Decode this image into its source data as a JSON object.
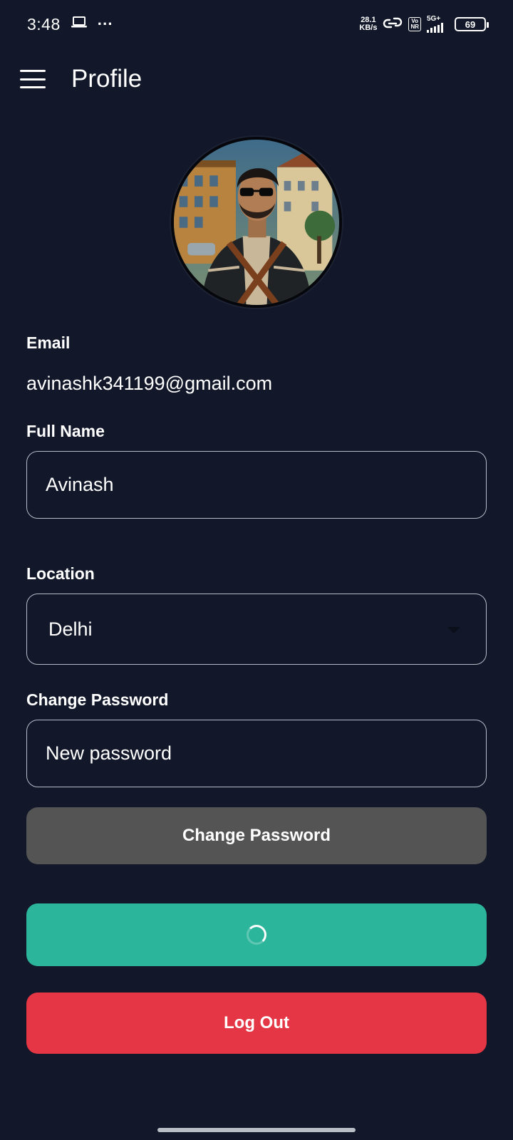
{
  "status_bar": {
    "time": "3:48",
    "overflow": "···",
    "net_speed_value": "28.1",
    "net_speed_unit": "KB/s",
    "volte_top": "Vo",
    "volte_bottom": "NR",
    "network": "5G+",
    "battery": "69"
  },
  "app_bar": {
    "title": "Profile"
  },
  "profile": {
    "email_label": "Email",
    "email_value": "avinashk341199@gmail.com",
    "full_name_label": "Full Name",
    "full_name_value": "Avinash",
    "location_label": "Location",
    "location_value": "Delhi",
    "change_password_label": "Change Password",
    "new_password_placeholder": "New password"
  },
  "buttons": {
    "change_password": "Change Password",
    "log_out": "Log Out"
  },
  "colors": {
    "background": "#121829",
    "change_password_button": "#545454",
    "save_button": "#2bb59b",
    "log_out_button": "#e53645",
    "field_border": "#b7bcc8"
  },
  "icons": {
    "menu": "hamburger-icon",
    "dropdown": "caret-down-icon",
    "loading": "spinner-icon"
  }
}
